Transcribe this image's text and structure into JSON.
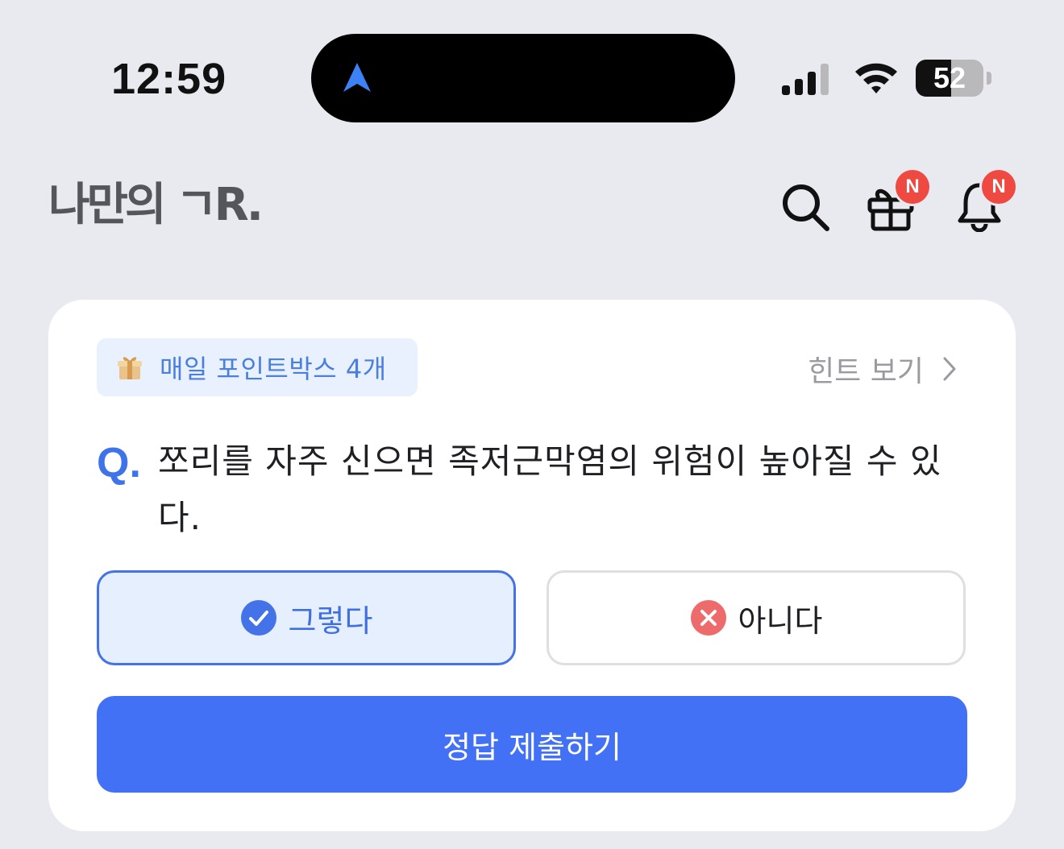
{
  "status_bar": {
    "time": "12:59",
    "battery_level": "52",
    "battery_fraction": 0.52
  },
  "header": {
    "logo": "나만의 ㄱR.",
    "icons": [
      "search-icon",
      "gift-icon",
      "bell-icon"
    ],
    "gift_badge": "N",
    "bell_badge": "N"
  },
  "quiz": {
    "pointbox_label": "매일 포인트박스 4개",
    "hint_label": "힌트 보기",
    "q_marker": "Q.",
    "question": "쪼리를 자주 신으면 족저근막염의 위험이 높아질 수 있다.",
    "answer_yes": "그렇다",
    "answer_no": "아니다",
    "submit": "정답 제출하기"
  },
  "colors": {
    "accent": "#4371f5",
    "selected_bg": "#e6effd",
    "badge": "#ef4a42",
    "background": "#e9eaef"
  }
}
